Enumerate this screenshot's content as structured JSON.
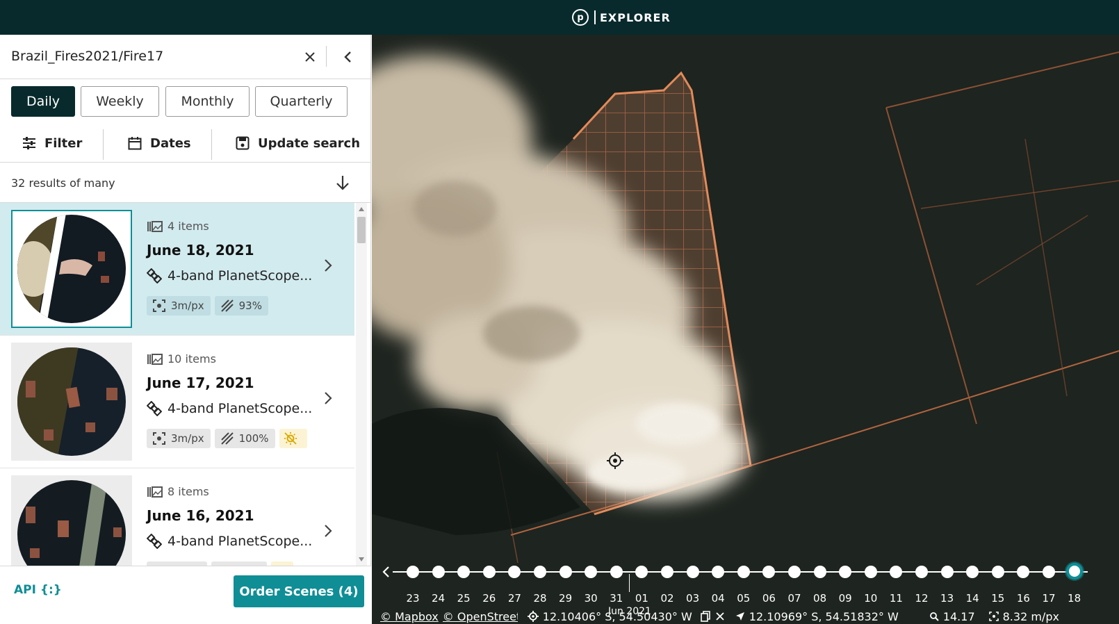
{
  "header": {
    "logo_letter": "p",
    "title": "EXPLORER"
  },
  "search": {
    "query": "Brazil_Fires2021/Fire17"
  },
  "periods": [
    "Daily",
    "Weekly",
    "Monthly",
    "Quarterly"
  ],
  "active_period": "Daily",
  "actions": {
    "filter": "Filter",
    "dates": "Dates",
    "update": "Update search"
  },
  "results": {
    "count_text": "32 results of many"
  },
  "cards": [
    {
      "items": "4 items",
      "date": "June 18, 2021",
      "product": "4-band PlanetScope...",
      "resolution": "3m/px",
      "coverage": "93%",
      "sun_icon": false,
      "selected": true
    },
    {
      "items": "10 items",
      "date": "June 17, 2021",
      "product": "4-band PlanetScope...",
      "resolution": "3m/px",
      "coverage": "100%",
      "sun_icon": true,
      "selected": false
    },
    {
      "items": "8 items",
      "date": "June 16, 2021",
      "product": "4-band PlanetScope...",
      "resolution": "",
      "coverage": "",
      "sun_icon": true,
      "selected": false
    }
  ],
  "footer": {
    "api": "API {:}",
    "order": "Order Scenes (4)"
  },
  "timeline": {
    "month_label": "Jun 2021",
    "days": [
      "23",
      "24",
      "25",
      "26",
      "27",
      "28",
      "29",
      "30",
      "31",
      "01",
      "02",
      "03",
      "04",
      "05",
      "06",
      "07",
      "08",
      "09",
      "10",
      "11",
      "12",
      "13",
      "14",
      "15",
      "16",
      "17",
      "18"
    ],
    "active_day": "18"
  },
  "status": {
    "mapbox": "© Mapbox",
    "osm": "© OpenStreetM",
    "center_coords": "12.10406° S, 54.50430° W",
    "cursor_coords": "12.10969° S, 54.51832° W",
    "zoom": "14.17",
    "resolution": "8.32 m/px"
  },
  "colors": {
    "header_bg": "#082a2c",
    "accent": "#0f8e96",
    "selected_bg": "#d2ebef"
  }
}
